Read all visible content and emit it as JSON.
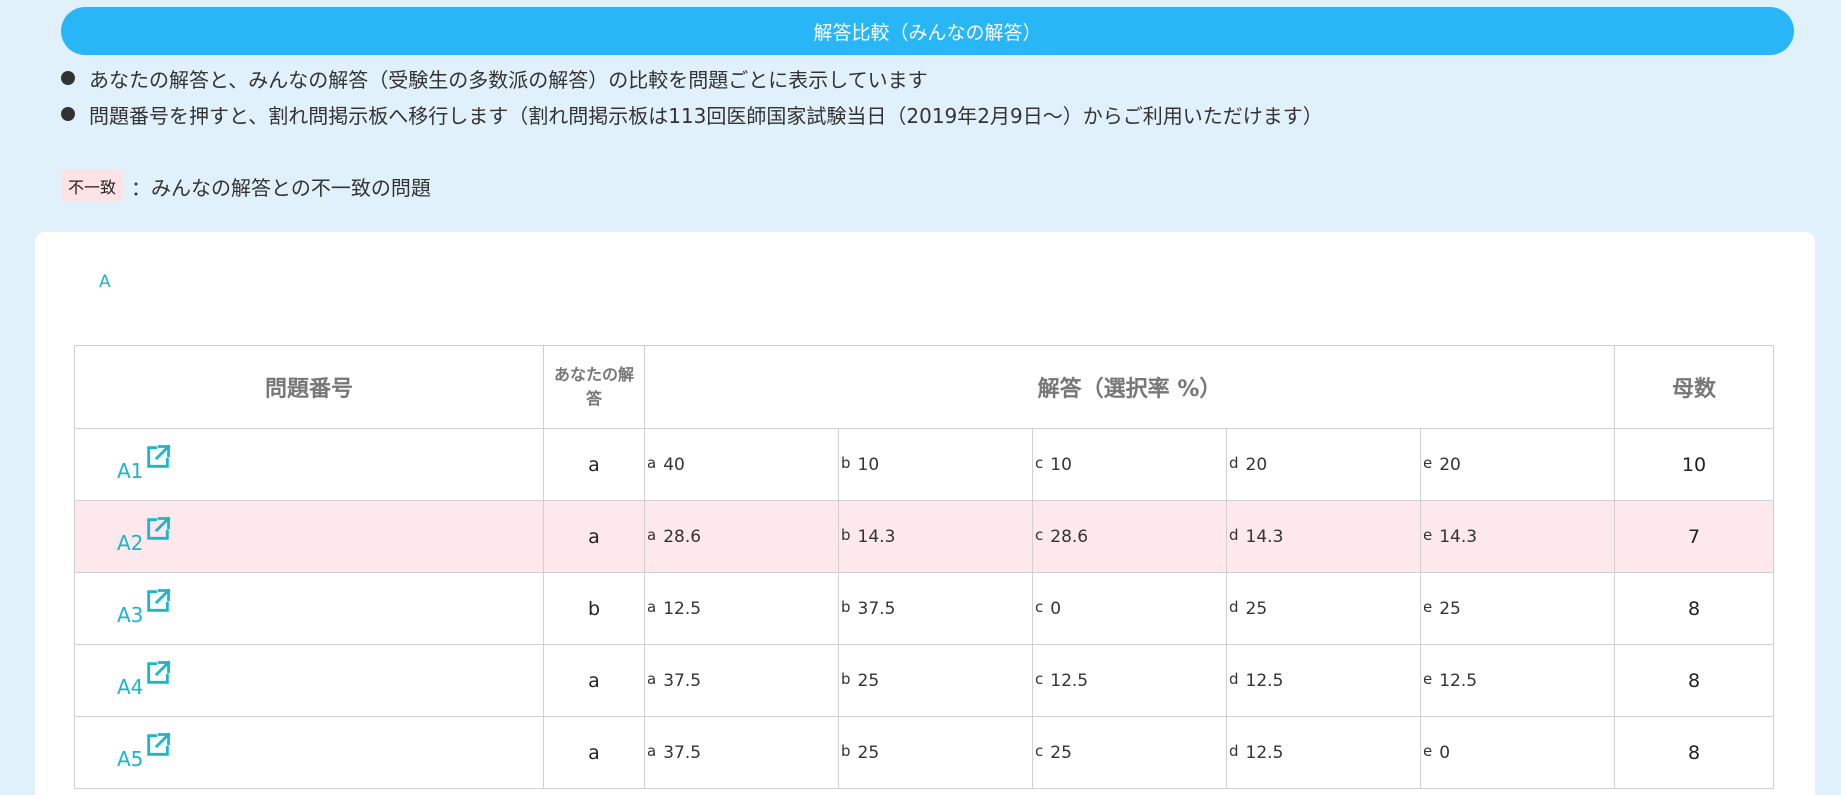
{
  "banner": {
    "title": "解答比較（みんなの解答）"
  },
  "notes": [
    "あなたの解答と、みんなの解答（受験生の多数派の解答）の比較を問題ごとに表示しています",
    "問題番号を押すと、割れ問掲示板へ移行します（割れ問掲示板は113回医師国家試験当日（2019年2月9日〜）からご利用いただけます）"
  ],
  "legend": {
    "badge": "不一致",
    "text": "：みんなの解答との不一致の問題"
  },
  "section": {
    "label": "A"
  },
  "table": {
    "headers": {
      "question": "問題番号",
      "your_answer": "あなたの解答",
      "answers": "解答（選択率 %）",
      "count": "母数"
    },
    "rows": [
      {
        "q": "A1",
        "yours": "a",
        "mismatch": false,
        "opts": [
          {
            "l": "a",
            "v": "40"
          },
          {
            "l": "b",
            "v": "10"
          },
          {
            "l": "c",
            "v": "10"
          },
          {
            "l": "d",
            "v": "20"
          },
          {
            "l": "e",
            "v": "20"
          }
        ],
        "count": "10"
      },
      {
        "q": "A2",
        "yours": "a",
        "mismatch": true,
        "opts": [
          {
            "l": "a",
            "v": "28.6"
          },
          {
            "l": "b",
            "v": "14.3"
          },
          {
            "l": "c",
            "v": "28.6"
          },
          {
            "l": "d",
            "v": "14.3"
          },
          {
            "l": "e",
            "v": "14.3"
          }
        ],
        "count": "7"
      },
      {
        "q": "A3",
        "yours": "b",
        "mismatch": false,
        "opts": [
          {
            "l": "a",
            "v": "12.5"
          },
          {
            "l": "b",
            "v": "37.5"
          },
          {
            "l": "c",
            "v": "0"
          },
          {
            "l": "d",
            "v": "25"
          },
          {
            "l": "e",
            "v": "25"
          }
        ],
        "count": "8"
      },
      {
        "q": "A4",
        "yours": "a",
        "mismatch": false,
        "opts": [
          {
            "l": "a",
            "v": "37.5"
          },
          {
            "l": "b",
            "v": "25"
          },
          {
            "l": "c",
            "v": "12.5"
          },
          {
            "l": "d",
            "v": "12.5"
          },
          {
            "l": "e",
            "v": "12.5"
          }
        ],
        "count": "8"
      },
      {
        "q": "A5",
        "yours": "a",
        "mismatch": false,
        "opts": [
          {
            "l": "a",
            "v": "37.5"
          },
          {
            "l": "b",
            "v": "25"
          },
          {
            "l": "c",
            "v": "25"
          },
          {
            "l": "d",
            "v": "12.5"
          },
          {
            "l": "e",
            "v": "0"
          }
        ],
        "count": "8"
      }
    ]
  },
  "colors": {
    "background": "#e1f1fb",
    "banner": "#29b6f6",
    "link": "#1cb5c9",
    "mismatch_row": "#fde8ec"
  },
  "icons": {
    "question_link": "external-link-icon"
  }
}
